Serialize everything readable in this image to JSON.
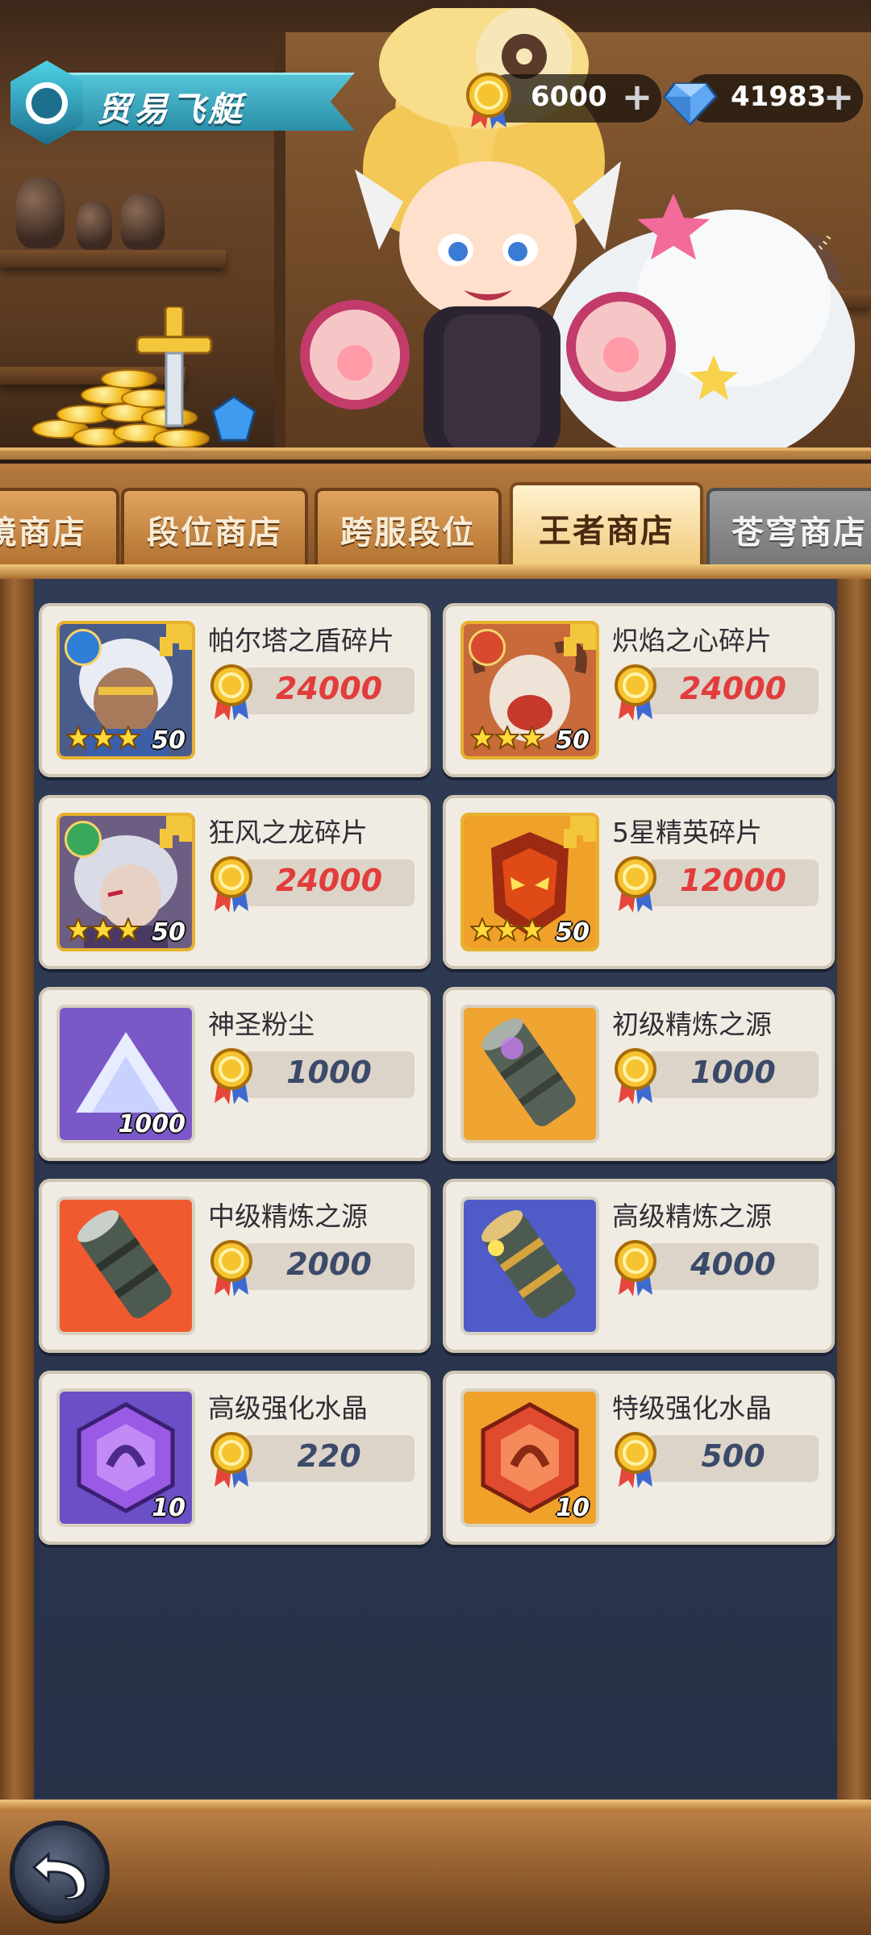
{
  "header": {
    "title": "贸易飞艇",
    "title_icon": "shield-crest-icon",
    "gold": {
      "icon": "gold-coin-icon",
      "amount": "6000",
      "add_label": "+"
    },
    "diamond": {
      "icon": "diamond-icon",
      "amount": "41983",
      "add_label": "+"
    }
  },
  "tabs": [
    {
      "label": "境商店",
      "state": "normal"
    },
    {
      "label": "段位商店",
      "state": "normal"
    },
    {
      "label": "跨服段位",
      "state": "normal"
    },
    {
      "label": "王者商店",
      "state": "active"
    },
    {
      "label": "苍穹商店",
      "state": "disabled"
    }
  ],
  "items": [
    {
      "name": "帕尔塔之盾碎片",
      "price": "24000",
      "price_color": "red",
      "icon": "hero-shard-palta-icon",
      "stars": "50",
      "star_count": 3,
      "faction": "water"
    },
    {
      "name": "炽焰之心碎片",
      "price": "24000",
      "price_color": "red",
      "icon": "hero-shard-flame-heart-icon",
      "stars": "50",
      "star_count": 3,
      "faction": "fire"
    },
    {
      "name": "狂风之龙碎片",
      "price": "24000",
      "price_color": "red",
      "icon": "hero-shard-wind-dragon-icon",
      "stars": "50",
      "star_count": 3,
      "faction": "wind"
    },
    {
      "name": "5星精英碎片",
      "price": "12000",
      "price_color": "red",
      "icon": "elite-shard-mask-icon",
      "stars": "50",
      "star_count": 3,
      "faction": "none"
    },
    {
      "name": "神圣粉尘",
      "price": "1000",
      "price_color": "blue",
      "icon": "holy-dust-icon",
      "quantity": "1000"
    },
    {
      "name": "初级精炼之源",
      "price": "1000",
      "price_color": "blue",
      "icon": "refine-source-basic-icon",
      "quantity": ""
    },
    {
      "name": "中级精炼之源",
      "price": "2000",
      "price_color": "blue",
      "icon": "refine-source-mid-icon",
      "quantity": ""
    },
    {
      "name": "高级精炼之源",
      "price": "4000",
      "price_color": "blue",
      "icon": "refine-source-high-icon",
      "quantity": ""
    },
    {
      "name": "高级强化水晶",
      "price": "220",
      "price_color": "blue",
      "icon": "purple-crystal-icon",
      "quantity": "10"
    },
    {
      "name": "特级强化水晶",
      "price": "500",
      "price_color": "blue",
      "icon": "orange-crystal-icon",
      "quantity": "10"
    }
  ],
  "price_icon": "gold-medal-coin-icon",
  "footer": {
    "back_icon": "back-arrow-icon"
  },
  "colors": {
    "price_red": "#e23d3d",
    "price_blue": "#3c4a6a",
    "active_tab": "#f0c777",
    "ribbon": "#2a8fa8"
  }
}
